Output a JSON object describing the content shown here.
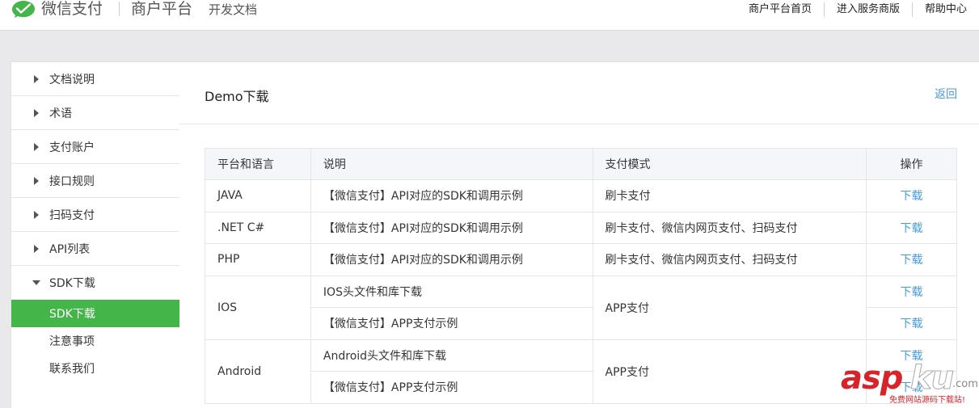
{
  "header": {
    "brand": "微信支付",
    "sub": "商户平台",
    "doc": "开发文档",
    "nav": [
      "商户平台首页",
      "进入服务商版",
      "帮助中心"
    ],
    "accent": "#44b549"
  },
  "sidebar": {
    "items": [
      {
        "label": "文档说明"
      },
      {
        "label": "术语"
      },
      {
        "label": "支付账户"
      },
      {
        "label": "接口规则"
      },
      {
        "label": "扫码支付"
      },
      {
        "label": "API列表"
      },
      {
        "label": "SDK下载"
      }
    ],
    "sub_items": [
      {
        "label": "SDK下载"
      },
      {
        "label": "注意事项"
      },
      {
        "label": "联系我们"
      }
    ],
    "active_color": "#44b549"
  },
  "main": {
    "title": "Demo下载",
    "back": "返回",
    "table": {
      "headers": [
        "平台和语言",
        "说明",
        "支付模式",
        "操作"
      ],
      "rows": [
        {
          "platform": "JAVA",
          "desc": "【微信支付】API对应的SDK和调用示例",
          "mode": "刷卡支付",
          "op": "下载"
        },
        {
          "platform": ".NET C#",
          "desc": "【微信支付】API对应的SDK和调用示例",
          "mode": "刷卡支付、微信内网页支付、扫码支付",
          "op": "下载"
        },
        {
          "platform": "PHP",
          "desc": "【微信支付】API对应的SDK和调用示例",
          "mode": "刷卡支付、微信内网页支付、扫码支付",
          "op": "下载"
        },
        {
          "platform": "IOS",
          "desc": "IOS头文件和库下载",
          "mode": "APP支付",
          "op": "下载"
        },
        {
          "desc": "【微信支付】APP支付示例",
          "op": "下载"
        },
        {
          "platform": "Android",
          "desc": "Android头文件和库下载",
          "mode": "APP支付",
          "op": "下载"
        },
        {
          "desc": "【微信支付】APP支付示例",
          "op": "下载"
        }
      ]
    },
    "link_color": "#459ae9"
  },
  "watermark": {
    "asp": "asp",
    "ku": "ku",
    "com": ".com",
    "sub": "免费网站源码下载站!"
  }
}
